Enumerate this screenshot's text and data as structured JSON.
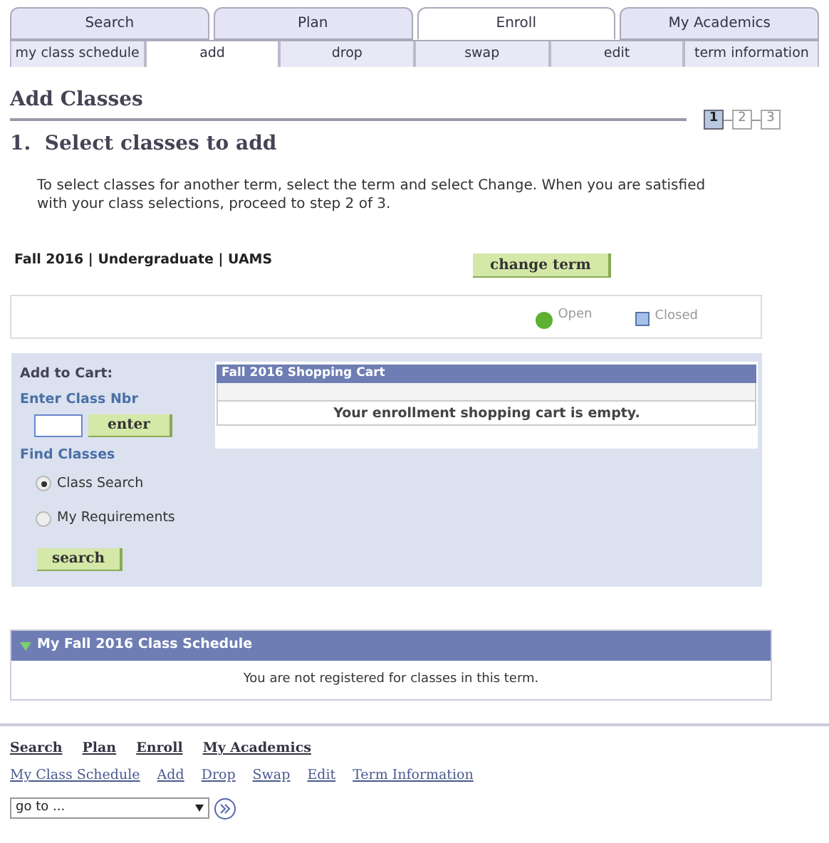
{
  "tabs": [
    {
      "label": "Search",
      "selected": false
    },
    {
      "label": "Plan",
      "selected": false
    },
    {
      "label": "Enroll",
      "selected": true
    },
    {
      "label": "My Academics",
      "selected": false
    }
  ],
  "subtabs": [
    {
      "label": "my class schedule",
      "selected": false
    },
    {
      "label": "add",
      "selected": true
    },
    {
      "label": "drop",
      "selected": false
    },
    {
      "label": "swap",
      "selected": false
    },
    {
      "label": "edit",
      "selected": false
    },
    {
      "label": "term information",
      "selected": false
    }
  ],
  "page_title": "Add Classes",
  "steps": [
    {
      "label": "1",
      "selected": true
    },
    {
      "label": "2",
      "selected": false
    },
    {
      "label": "3",
      "selected": false
    }
  ],
  "step_heading": "1.  Select classes to add",
  "instructions": "To select classes for another term, select the term and select Change.  When you are satisfied with your class selections, proceed to step 2 of 3.",
  "term": "Fall 2016 | Undergraduate | UAMS",
  "change_term_button": "change term",
  "legend": [
    {
      "kind": "circle",
      "label": "Open",
      "color": "#5db030"
    },
    {
      "kind": "square",
      "label": "Closed",
      "color": "#a6c0e8"
    }
  ],
  "add_to_cart": {
    "title": "Add to Cart:",
    "class_nbr_label": "Enter Class Nbr",
    "enter_button": "enter",
    "find_label": "Find Classes",
    "options": [
      {
        "label": "Class Search",
        "selected": true
      },
      {
        "label": "My Requirements",
        "selected": false
      }
    ],
    "search_button": "search"
  },
  "shopping_cart": {
    "title": "Fall 2016 Shopping Cart",
    "message": "Your enrollment shopping cart is empty."
  },
  "schedule": {
    "title": "My Fall 2016 Class Schedule",
    "expanded": true,
    "message": "You are not registered for classes in this term."
  },
  "footer_links": [
    "Search",
    "Plan",
    "Enroll",
    "My Academics"
  ],
  "footer_sublinks": [
    "My Class Schedule",
    "Add",
    "Drop",
    "Swap",
    "Edit",
    "Term Information"
  ],
  "goto": {
    "value": "go to ..."
  }
}
